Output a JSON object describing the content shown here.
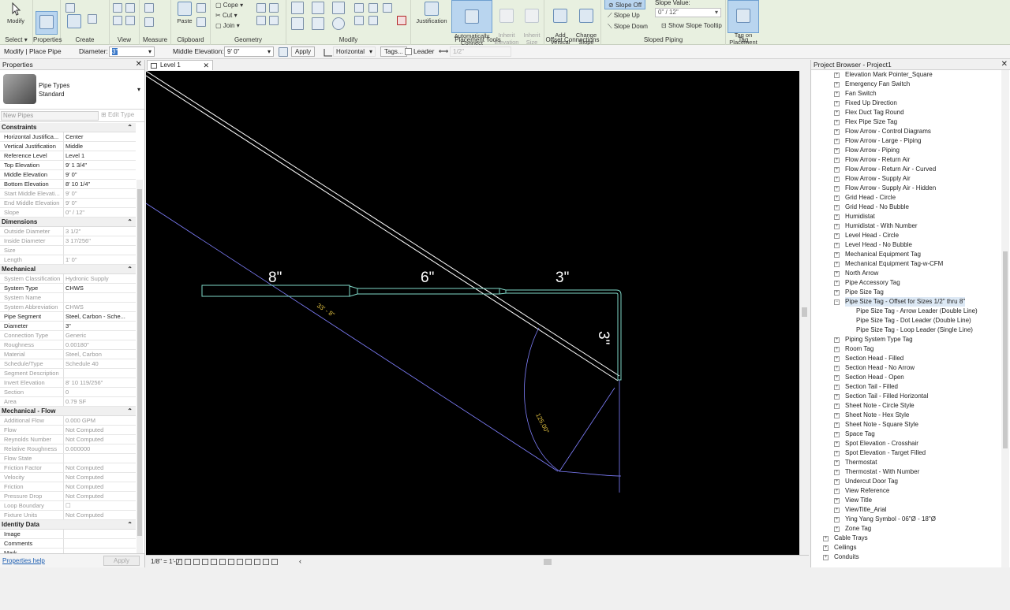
{
  "ribbon": {
    "select": {
      "modify": "Modify",
      "select_label": "Select ▾"
    },
    "properties_label": "Properties",
    "create_label": "Create",
    "view_label": "View",
    "measure_label": "Measure",
    "clipboard": {
      "paste": "Paste",
      "label": "Clipboard"
    },
    "geometry": {
      "cope": "Cope",
      "cut": "Cut",
      "join": "Join",
      "label": "Geometry"
    },
    "modify_label": "Modify",
    "placement_tools": {
      "justification": "Justification",
      "auto_connect": "Automatically\nConnect",
      "inherit_elevation": "Inherit\nElevation",
      "inherit_size": "Inherit\nSize",
      "label": "Placement Tools"
    },
    "offset_connections": {
      "add_vertical": "Add\nVertical",
      "change_slope": "Change\nSlope",
      "label": "Offset Connections"
    },
    "sloped_piping": {
      "slope_off": "Slope Off",
      "slope_up": "Slope Up",
      "slope_down": "Slope Down",
      "slope_value_label": "Slope Value:",
      "slope_value": "0\" / 12\"",
      "show_slope_tooltip": "Show Slope Tooltip",
      "label": "Sloped Piping"
    },
    "tag": {
      "tag_on_placement": "Tag on\nPlacement",
      "label": "Tag"
    }
  },
  "options_bar": {
    "context": "Modify | Place Pipe",
    "diameter_label": "Diameter:",
    "diameter_value": "3\"",
    "middle_elevation_label": "Middle Elevation:",
    "middle_elevation_value": "9'  0\"",
    "apply": "Apply",
    "orientation": "Horizontal",
    "tags": "Tags...",
    "leader": "Leader",
    "leader_length": "1/2\""
  },
  "properties": {
    "title": "Properties",
    "type_family": "Pipe Types",
    "type_name": "Standard",
    "instance_selector": "New Pipes",
    "edit_type": "Edit Type",
    "help": "Properties help",
    "apply": "Apply",
    "sections": [
      {
        "name": "Constraints",
        "rows": [
          {
            "k": "Horizontal Justifica...",
            "v": "Center"
          },
          {
            "k": "Vertical Justification",
            "v": "Middle"
          },
          {
            "k": "Reference Level",
            "v": "Level 1"
          },
          {
            "k": "Top Elevation",
            "v": "9'  1 3/4\""
          },
          {
            "k": "Middle Elevation",
            "v": "9'  0\""
          },
          {
            "k": "Bottom Elevation",
            "v": "8'  10 1/4\""
          },
          {
            "k": "Start Middle Elevati...",
            "v": "9'  0\"",
            "ro": true
          },
          {
            "k": "End Middle Elevation",
            "v": "9'  0\"",
            "ro": true
          },
          {
            "k": "Slope",
            "v": "0\" / 12\"",
            "ro": true
          }
        ]
      },
      {
        "name": "Dimensions",
        "rows": [
          {
            "k": "Outside Diameter",
            "v": "3 1/2\"",
            "ro": true
          },
          {
            "k": "Inside Diameter",
            "v": "3 17/256\"",
            "ro": true
          },
          {
            "k": "Size",
            "v": "",
            "ro": true
          },
          {
            "k": "Length",
            "v": "1'  0\"",
            "ro": true
          }
        ]
      },
      {
        "name": "Mechanical",
        "rows": [
          {
            "k": "System Classification",
            "v": "Hydronic Supply",
            "ro": true
          },
          {
            "k": "System Type",
            "v": "CHWS"
          },
          {
            "k": "System Name",
            "v": "",
            "ro": true
          },
          {
            "k": "System Abbreviation",
            "v": "CHWS",
            "ro": true
          },
          {
            "k": "Pipe Segment",
            "v": "Steel, Carbon - Sche..."
          },
          {
            "k": "Diameter",
            "v": "3\""
          },
          {
            "k": "Connection Type",
            "v": "Generic",
            "ro": true
          },
          {
            "k": "Roughness",
            "v": "0.00180\"",
            "ro": true
          },
          {
            "k": "Material",
            "v": "Steel, Carbon",
            "ro": true
          },
          {
            "k": "Schedule/Type",
            "v": "Schedule 40",
            "ro": true
          },
          {
            "k": "Segment Description",
            "v": "",
            "ro": true
          },
          {
            "k": "Invert Elevation",
            "v": "8'  10 119/256\"",
            "ro": true
          },
          {
            "k": "Section",
            "v": "0",
            "ro": true
          },
          {
            "k": "Area",
            "v": "0.79 SF",
            "ro": true
          }
        ]
      },
      {
        "name": "Mechanical - Flow",
        "rows": [
          {
            "k": "Additional Flow",
            "v": "0.000 GPM",
            "ro": true
          },
          {
            "k": "Flow",
            "v": "Not Computed",
            "ro": true
          },
          {
            "k": "Reynolds Number",
            "v": "Not Computed",
            "ro": true
          },
          {
            "k": "Relative Roughness",
            "v": "0.000000",
            "ro": true
          },
          {
            "k": "Flow State",
            "v": "",
            "ro": true
          },
          {
            "k": "Friction Factor",
            "v": "Not Computed",
            "ro": true
          },
          {
            "k": "Velocity",
            "v": "Not Computed",
            "ro": true
          },
          {
            "k": "Friction",
            "v": "Not Computed",
            "ro": true
          },
          {
            "k": "Pressure Drop",
            "v": "Not Computed",
            "ro": true
          },
          {
            "k": "Loop Boundary",
            "v": "☐",
            "ro": true
          },
          {
            "k": "Fixture Units",
            "v": "Not Computed",
            "ro": true
          }
        ]
      },
      {
        "name": "Identity Data",
        "rows": [
          {
            "k": "Image",
            "v": ""
          },
          {
            "k": "Comments",
            "v": ""
          },
          {
            "k": "Mark",
            "v": ""
          }
        ]
      }
    ]
  },
  "view": {
    "tab": "Level 1",
    "scale": "1/8\" = 1'-0\"",
    "labels": {
      "size_8": "8\"",
      "size_6": "6\"",
      "size_3": "3\"",
      "size_3_vert": "3\"",
      "length_dim": "33' - 8\"",
      "angle_dim": "125.00°"
    }
  },
  "browser": {
    "title": "Project Browser - Project1",
    "items": [
      {
        "label": "Elevation Mark Pointer_Square",
        "level": 2
      },
      {
        "label": "Emergency Fan Switch",
        "level": 2
      },
      {
        "label": "Fan Switch",
        "level": 2
      },
      {
        "label": "Fixed Up Direction",
        "level": 2
      },
      {
        "label": "Flex Duct Tag Round",
        "level": 2
      },
      {
        "label": "Flex Pipe Size Tag",
        "level": 2
      },
      {
        "label": "Flow Arrow - Control Diagrams",
        "level": 2
      },
      {
        "label": "Flow Arrow - Large - Piping",
        "level": 2
      },
      {
        "label": "Flow Arrow - Piping",
        "level": 2
      },
      {
        "label": "Flow Arrow - Return Air",
        "level": 2
      },
      {
        "label": "Flow Arrow - Return Air - Curved",
        "level": 2
      },
      {
        "label": "Flow Arrow - Supply Air",
        "level": 2
      },
      {
        "label": "Flow Arrow - Supply Air - Hidden",
        "level": 2
      },
      {
        "label": "Grid Head - Circle",
        "level": 2
      },
      {
        "label": "Grid Head - No Bubble",
        "level": 2
      },
      {
        "label": "Humidistat",
        "level": 2
      },
      {
        "label": "Humidistat - With Number",
        "level": 2
      },
      {
        "label": "Level Head - Circle",
        "level": 2
      },
      {
        "label": "Level Head - No Bubble",
        "level": 2
      },
      {
        "label": "Mechanical Equipment Tag",
        "level": 2
      },
      {
        "label": "Mechanical Equipment Tag-w-CFM",
        "level": 2
      },
      {
        "label": "North Arrow",
        "level": 2
      },
      {
        "label": "Pipe Accessory Tag",
        "level": 2
      },
      {
        "label": "Pipe Size Tag",
        "level": 2
      },
      {
        "label": "Pipe Size Tag - Offset for Sizes 1/2\" thru 8\"",
        "level": 2,
        "expanded": true,
        "selected": true
      },
      {
        "label": "Pipe Size Tag - Arrow Leader (Double Line)",
        "level": 3
      },
      {
        "label": "Pipe Size Tag - Dot Leader (Double Line)",
        "level": 3
      },
      {
        "label": "Pipe Size Tag - Loop Leader (Single Line)",
        "level": 3
      },
      {
        "label": "Piping System Type Tag",
        "level": 2
      },
      {
        "label": "Room Tag",
        "level": 2
      },
      {
        "label": "Section Head - Filled",
        "level": 2
      },
      {
        "label": "Section Head - No Arrow",
        "level": 2
      },
      {
        "label": "Section Head - Open",
        "level": 2
      },
      {
        "label": "Section Tail - Filled",
        "level": 2
      },
      {
        "label": "Section Tail - Filled Horizontal",
        "level": 2
      },
      {
        "label": "Sheet Note - Circle Style",
        "level": 2
      },
      {
        "label": "Sheet Note - Hex Style",
        "level": 2
      },
      {
        "label": "Sheet Note - Square Style",
        "level": 2
      },
      {
        "label": "Space Tag",
        "level": 2
      },
      {
        "label": "Spot Elevation - Crosshair",
        "level": 2
      },
      {
        "label": "Spot Elevation - Target Filled",
        "level": 2
      },
      {
        "label": "Thermostat",
        "level": 2
      },
      {
        "label": "Thermostat - With Number",
        "level": 2
      },
      {
        "label": "Undercut Door Tag",
        "level": 2
      },
      {
        "label": "View Reference",
        "level": 2
      },
      {
        "label": "View Title",
        "level": 2
      },
      {
        "label": "ViewTitle_Arial",
        "level": 2
      },
      {
        "label": "Ying Yang Symbol - 06\"Ø - 18\"Ø",
        "level": 2
      },
      {
        "label": "Zone Tag",
        "level": 2
      },
      {
        "label": "Cable Trays",
        "level": 1
      },
      {
        "label": "Ceilings",
        "level": 1
      },
      {
        "label": "Conduits",
        "level": 1
      }
    ]
  },
  "colors": {
    "canvas": "#000000",
    "pipe": "#7fd8c8",
    "dimension": "#8080ff",
    "text_white": "#ffffff",
    "text_yellow": "#e0c040",
    "ribbon_bg": "#e8f0e0"
  }
}
